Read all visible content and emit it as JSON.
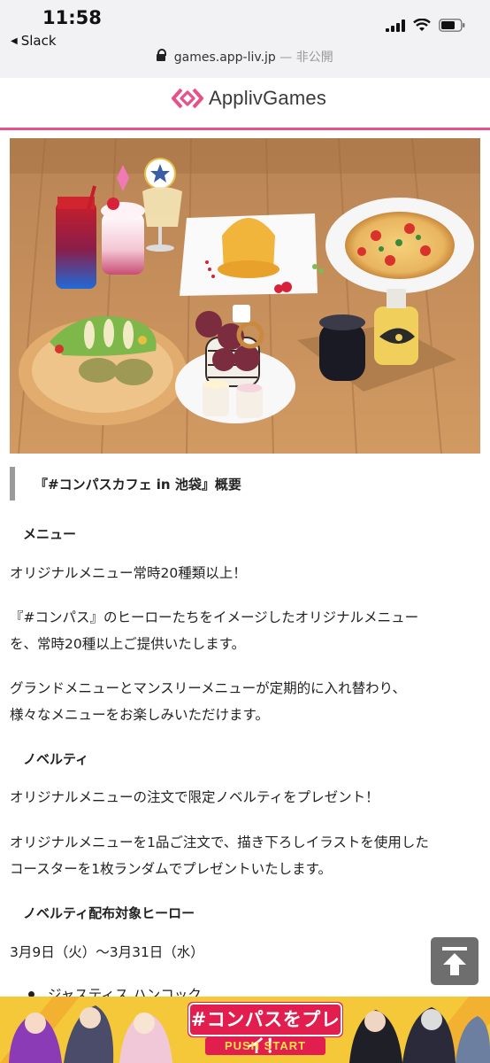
{
  "status": {
    "time": "11:58",
    "back_app": "Slack",
    "url": "games.app-liv.jp",
    "url_suffix": " — 非公開"
  },
  "site": {
    "brand": "ApplivGames",
    "accent": "#e8508a"
  },
  "article": {
    "heading": "『#コンパスカフェ in 池袋』概要",
    "sections": {
      "menu_title": "メニュー",
      "menu_lead": "オリジナルメニュー常時20種類以上！",
      "menu_p1_line1": "『#コンパス』のヒーローたちをイメージしたオリジナルメニュー",
      "menu_p1_line2": "を、常時20種以上ご提供いたします。",
      "menu_p2_line1": "グランドメニューとマンスリーメニューが定期的に入れ替わり、",
      "menu_p2_line2": "様々なメニューをお楽しみいただけます。",
      "novelty_title": "ノベルティ",
      "novelty_lead": "オリジナルメニューの注文で限定ノベルティをプレゼント！",
      "novelty_p1_line1": "オリジナルメニューを1品ご注文で、描き下ろしイラストを使用した",
      "novelty_p1_line2": "コースターを1枚ランダムでプレゼントいたします。",
      "hero_list_title": "ノベルティ配布対象ヒーロー",
      "period": "3月9日（火）～3月31日（水）",
      "bullet_1": "ジャスティス ハンコック"
    }
  },
  "banner": {
    "title": "#コンパスをプレイ！",
    "sub": "PUSH START"
  },
  "icons": {
    "to_top": "arrow-up-to-top-icon",
    "lock": "lock-icon",
    "signal": "signal-icon",
    "wifi": "wifi-icon",
    "battery": "battery-icon"
  }
}
